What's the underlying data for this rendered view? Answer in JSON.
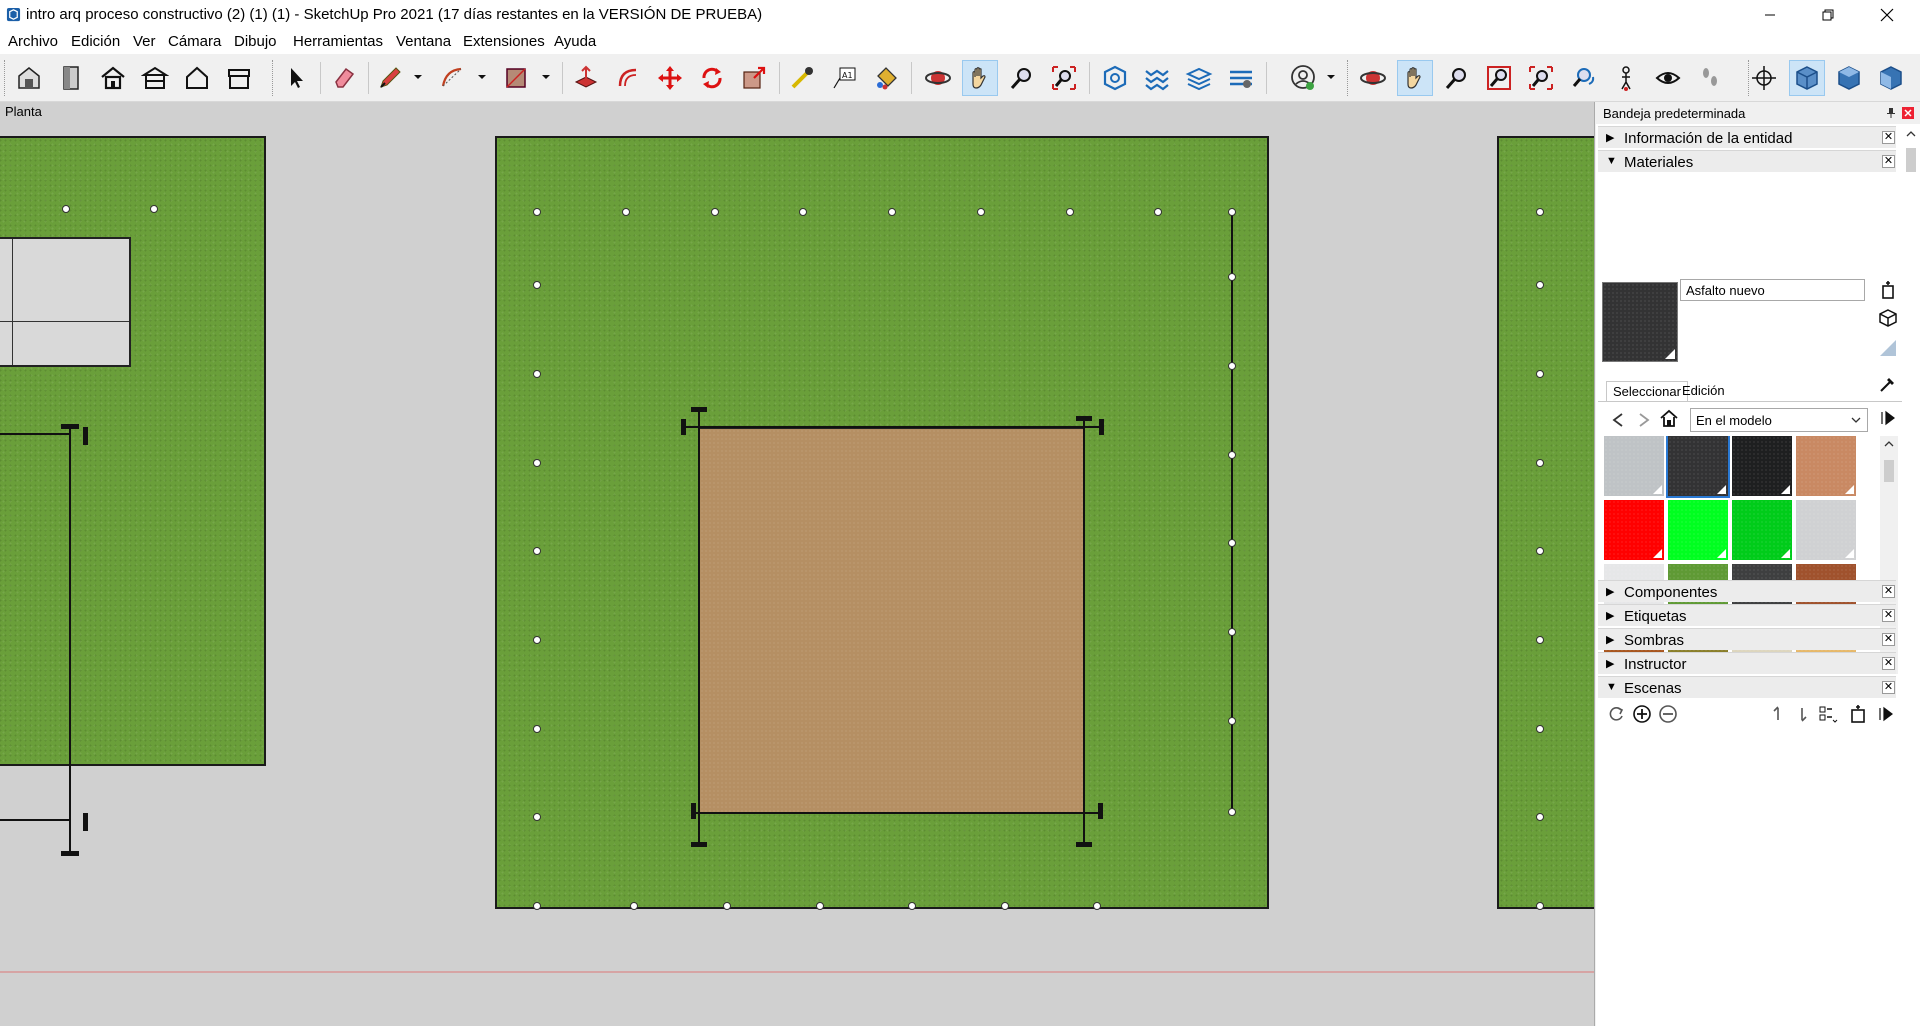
{
  "window": {
    "title": "intro arq proceso constructivo (2) (1) (1) - SketchUp Pro 2021 (17 días restantes en la VERSIÓN DE PRUEBA)",
    "controls": [
      "minimize",
      "restore",
      "close"
    ]
  },
  "menu": [
    "Archivo",
    "Edición",
    "Ver",
    "Cámara",
    "Dibujo",
    "Herramientas",
    "Ventana",
    "Extensiones",
    "Ayuda"
  ],
  "toolbar": {
    "tools": [
      "warehouse-icon",
      "door-icon",
      "house-icon",
      "house-section-icon",
      "house-outline-icon",
      "house-shed-icon",
      "select-icon",
      "eraser-icon",
      "pencil-icon",
      "arc-icon",
      "rectangle-icon",
      "push-pull-icon",
      "offset-icon",
      "move-icon",
      "rotate-icon",
      "scale-icon",
      "tape-measure-icon",
      "text-icon",
      "paint-bucket-icon",
      "orbit-icon",
      "pan-icon",
      "zoom-icon",
      "zoom-extents-icon",
      "solid-tools-icon",
      "section-plane-icon",
      "layers-icon",
      "styles-icon",
      "profile-icon",
      "orbit2-icon",
      "pan2-icon",
      "zoom2-icon",
      "zoom-window-icon",
      "zoom-extents2-icon",
      "previous-view-icon",
      "position-camera-icon",
      "look-around-icon",
      "walk-icon",
      "axes-icon",
      "iso-view-icon",
      "top-view-icon",
      "front-view-icon"
    ],
    "active": [
      "pan-icon",
      "pan2-icon",
      "iso-view-icon"
    ]
  },
  "viewport": {
    "scene_label": "Planta"
  },
  "tray": {
    "title": "Bandeja predeterminada",
    "panels": {
      "entity_info": "Información de la entidad",
      "materials": "Materiales",
      "components": "Componentes",
      "tags": "Etiquetas",
      "shadows": "Sombras",
      "instructor": "Instructor",
      "scenes": "Escenas"
    },
    "materials": {
      "current_name": "Asfalto nuevo",
      "tabs": [
        "Seleccionar",
        "Edición"
      ],
      "collection": "En el modelo",
      "swatches": [
        {
          "name": "light-gray",
          "color": "#bfc3c6"
        },
        {
          "name": "asphalt-new",
          "color": "#333334",
          "selected": true
        },
        {
          "name": "black-asphalt",
          "color": "#1e1f20"
        },
        {
          "name": "terracotta",
          "color": "#c98963"
        },
        {
          "name": "red",
          "color": "#ff0000"
        },
        {
          "name": "bright-green",
          "color": "#00ff20"
        },
        {
          "name": "green",
          "color": "#00cc1a"
        },
        {
          "name": "concrete-light",
          "color": "#d0d1d3"
        },
        {
          "name": "white-stucco",
          "color": "#e6e7e8"
        },
        {
          "name": "grass",
          "color": "#5f9a35"
        },
        {
          "name": "dark-asphalt",
          "color": "#3e3f40"
        },
        {
          "name": "brick",
          "color": "#a0522d"
        },
        {
          "name": "wood-brown",
          "color": "#a8561f"
        },
        {
          "name": "olive-ground",
          "color": "#8a7f2a"
        },
        {
          "name": "wood-light",
          "color": "#ddd6be"
        },
        {
          "name": "sand",
          "color": "#e6b86a"
        }
      ]
    }
  }
}
